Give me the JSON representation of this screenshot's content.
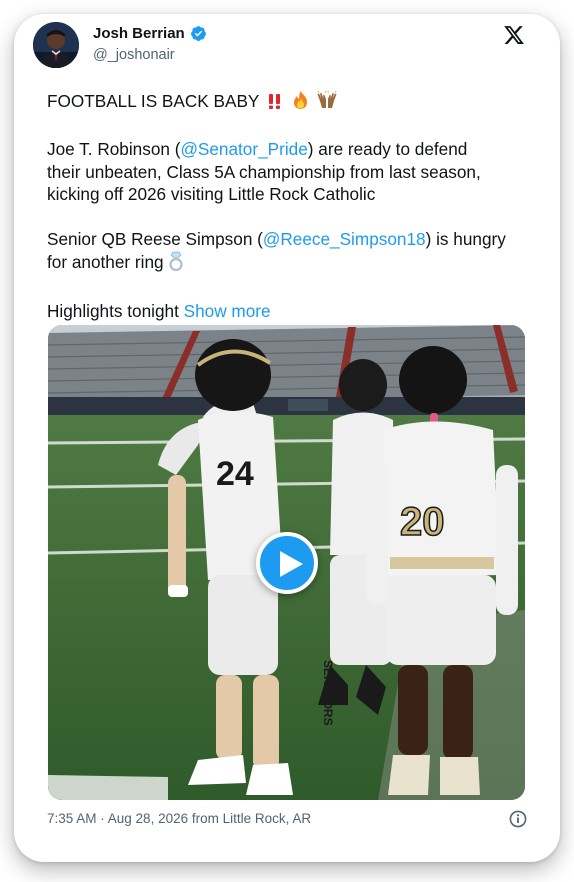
{
  "author": {
    "name": "Josh Berrian",
    "handle": "@_joshonair",
    "verified": true
  },
  "tweet": {
    "headline": "FOOTBALL IS BACK BABY",
    "headline_emojis": [
      "double-exclamation",
      "fire",
      "raising-hands"
    ],
    "p2": {
      "pre": "Joe T. Robinson (",
      "mention": "@Senator_Pride",
      "post": ") are ready to defend",
      "line2": "their unbeaten, Class 5A championship from last season,",
      "line3": "kicking off 2026 visiting Little Rock Catholic"
    },
    "p3": {
      "pre": "Senior QB Reese Simpson (",
      "mention": "@Reece_Simpson18",
      "post": ") is hungry",
      "line2": "for another ring",
      "line2_emoji": "ring"
    },
    "p4": {
      "text": "Highlights tonight ",
      "show_more": "Show more"
    }
  },
  "media": {
    "type": "video",
    "description": "football players on sideline",
    "jersey_numbers": [
      "24",
      "20"
    ],
    "team_text": "SENATORS"
  },
  "footer": {
    "timestamp": "7:35 AM · Aug 28, 2026 from Little Rock, AR"
  },
  "colors": {
    "link": "#1d9bf0",
    "secondary_text": "#536471",
    "primary_text": "#0f1419"
  }
}
